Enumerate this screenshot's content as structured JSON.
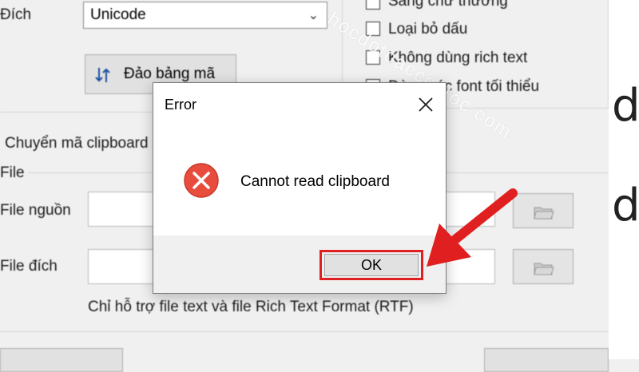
{
  "app": {
    "target_label": "Đích",
    "target_encoding": "Unicode",
    "swap_button": "Đảo bảng mã",
    "clipboard_option": "Chuyển mã clipboard",
    "file_group": "File",
    "source_file_label": "File nguồn",
    "target_file_label": "File đích",
    "support_note": "Chỉ hỗ trợ file text và file Rich Text Format (RTF)",
    "options": [
      "Sang chữ thường",
      "Loại bỏ dấu",
      "Không dùng rich text",
      "Dùng các font tối thiểu"
    ],
    "right_letters": [
      "d",
      "d"
    ]
  },
  "watermark": "hocdotoaccoctoc.com",
  "dialog": {
    "title": "Error",
    "message": "Cannot read clipboard",
    "ok_label": "OK"
  },
  "colors": {
    "error_red": "#e84c3d",
    "highlight_red": "#e02020",
    "dialog_footer": "#f0f0f0"
  },
  "icons": {
    "error": "error-x-circle-icon",
    "close": "close-icon",
    "swap": "swap-arrows-icon",
    "folder": "open-folder-icon",
    "pointer": "red-arrow-icon"
  }
}
